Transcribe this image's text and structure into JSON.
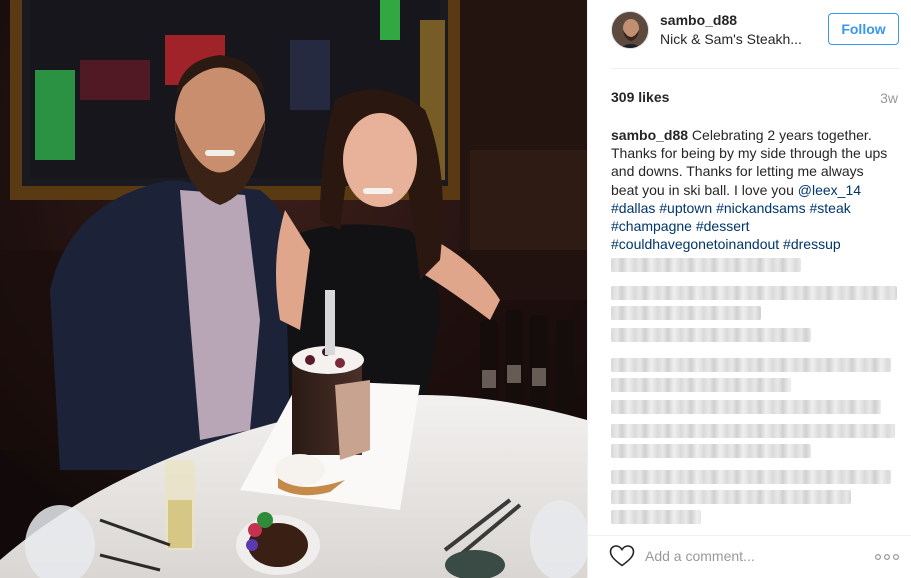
{
  "post": {
    "username": "sambo_d88",
    "location": "Nick & Sam's Steakh...",
    "follow_label": "Follow",
    "likes": "309 likes",
    "age": "3w",
    "caption": {
      "username": "sambo_d88",
      "text": " Celebrating 2 years together. Thanks for being by my side through the ups and downs. Thanks for letting me always beat you in ski ball. I love you ",
      "mention": "@leex_14",
      "hashtags": [
        "#dallas",
        "#uptown",
        "#nickandsams",
        "#steak",
        "#champagne",
        "#dessert",
        "#couldhavegonetoinandout",
        "#dressup"
      ]
    },
    "comment_placeholder": "Add a comment...",
    "icons": {
      "like": "heart-outline-icon",
      "more": "more-options-icon"
    }
  },
  "colors": {
    "accent": "#3897f0",
    "hashtag": "#003569",
    "muted": "#999999",
    "text": "#262626"
  }
}
